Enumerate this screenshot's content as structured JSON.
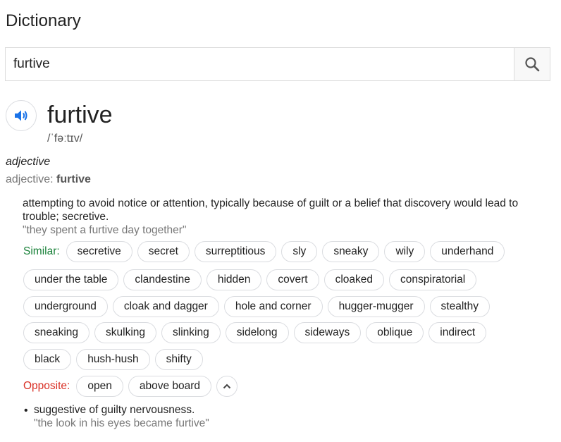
{
  "header": {
    "title": "Dictionary"
  },
  "search": {
    "value": "furtive"
  },
  "entry": {
    "word": "furtive",
    "phonetic": "/ˈfəːtɪv/",
    "part_of_speech": "adjective",
    "pos_label": "adjective:",
    "pos_word": "furtive"
  },
  "sense1": {
    "definition": "attempting to avoid notice or attention, typically because of guilt or a belief that discovery would lead to trouble; secretive.",
    "example": "\"they spent a furtive day together\"",
    "similar_label": "Similar:",
    "similar_row1": [
      "secretive",
      "secret",
      "surreptitious",
      "sly",
      "sneaky",
      "wily",
      "underhand"
    ],
    "similar_row2": [
      "under the table",
      "clandestine",
      "hidden",
      "covert",
      "cloaked",
      "conspiratorial"
    ],
    "similar_row3": [
      "underground",
      "cloak and dagger",
      "hole and corner",
      "hugger-mugger",
      "stealthy"
    ],
    "similar_row4": [
      "sneaking",
      "skulking",
      "slinking",
      "sidelong",
      "sideways",
      "oblique",
      "indirect"
    ],
    "similar_row5": [
      "black",
      "hush-hush",
      "shifty"
    ],
    "opposite_label": "Opposite:",
    "opposite": [
      "open",
      "above board"
    ]
  },
  "sense2": {
    "bullet": "•",
    "definition": "suggestive of guilty nervousness.",
    "example": "\"the look in his eyes became furtive\""
  },
  "icons": {
    "search": "search-icon",
    "speaker": "speaker-icon",
    "collapse": "chevron-up-icon"
  },
  "colors": {
    "similar_label": "#188038",
    "opposite_label": "#d93025",
    "speaker": "#1a73e8"
  }
}
